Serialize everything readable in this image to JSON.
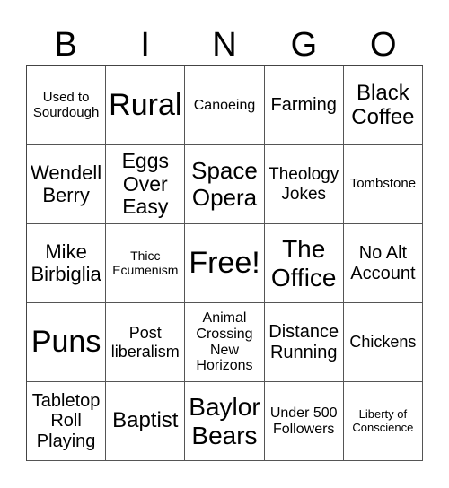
{
  "header": {
    "letters": [
      "B",
      "I",
      "N",
      "G",
      "O"
    ]
  },
  "grid": {
    "rows": [
      [
        "Used to Sourdough",
        "Rural",
        "Canoeing",
        "Farming",
        "Black Coffee"
      ],
      [
        "Wendell Berry",
        "Eggs Over Easy",
        "Space Opera",
        "Theology Jokes",
        "Tombstone"
      ],
      [
        "Mike Birbiglia",
        "Thicc Ecumenism",
        "Free!",
        "The Office",
        "No Alt Account"
      ],
      [
        "Puns",
        "Post liberalism",
        "Animal Crossing New Horizons",
        "Distance Running",
        "Chickens"
      ],
      [
        "Tabletop Roll Playing",
        "Baptist",
        "Baylor Bears",
        "Under 500 Followers",
        "Liberty of Conscience"
      ]
    ]
  }
}
